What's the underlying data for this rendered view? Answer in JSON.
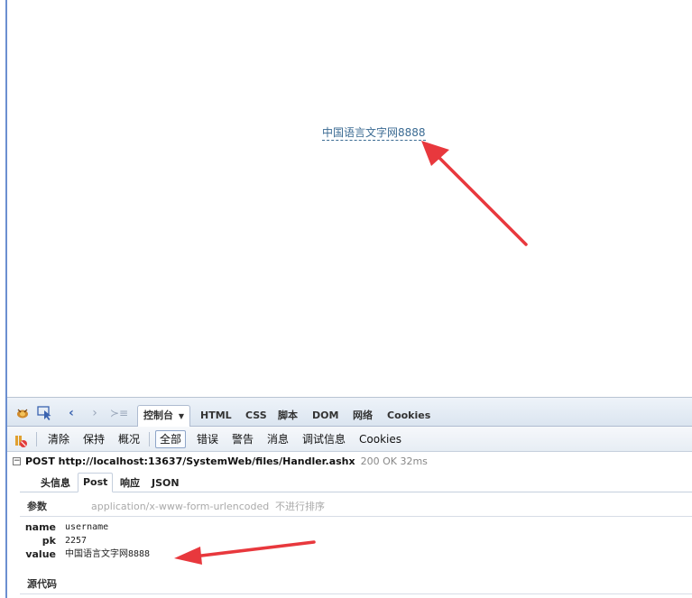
{
  "page": {
    "link_text": "中国语言文字网8888"
  },
  "colors": {
    "annotation_arrow": "#e8383d",
    "link": "#3b6b93",
    "left_border": "#6b8fd0"
  },
  "firebug": {
    "tabs": [
      {
        "label": "控制台",
        "has_dropdown": true,
        "active": true
      },
      {
        "label": "HTML"
      },
      {
        "label": "CSS"
      },
      {
        "label": "脚本"
      },
      {
        "label": "DOM"
      },
      {
        "label": "网络"
      },
      {
        "label": "Cookies"
      }
    ],
    "toolbar_icons": [
      "firebug-logo-icon",
      "inspect-element-icon",
      "back-icon",
      "forward-icon",
      "command-line-icon"
    ],
    "toolbar": {
      "clear": "清除",
      "persist": "保持",
      "profile": "概况",
      "filters": [
        "全部",
        "错误",
        "警告",
        "消息",
        "调试信息",
        "Cookies"
      ]
    },
    "request": {
      "toggle": "⊟",
      "line": "POST http://localhost:13637/SystemWeb/files/Handler.ashx",
      "status": "200 OK 32ms"
    },
    "subtabs": [
      "头信息",
      "Post",
      "响应",
      "JSON"
    ],
    "params": {
      "heading": "参数",
      "content_type": "application/x-www-form-urlencoded",
      "no_sort": "不进行排序",
      "rows": [
        {
          "name": "name",
          "value": "username"
        },
        {
          "name": "pk",
          "value": "2257"
        },
        {
          "name": "value",
          "value": "中国语言文字网8888"
        }
      ]
    },
    "source": {
      "heading": "源代码"
    }
  }
}
